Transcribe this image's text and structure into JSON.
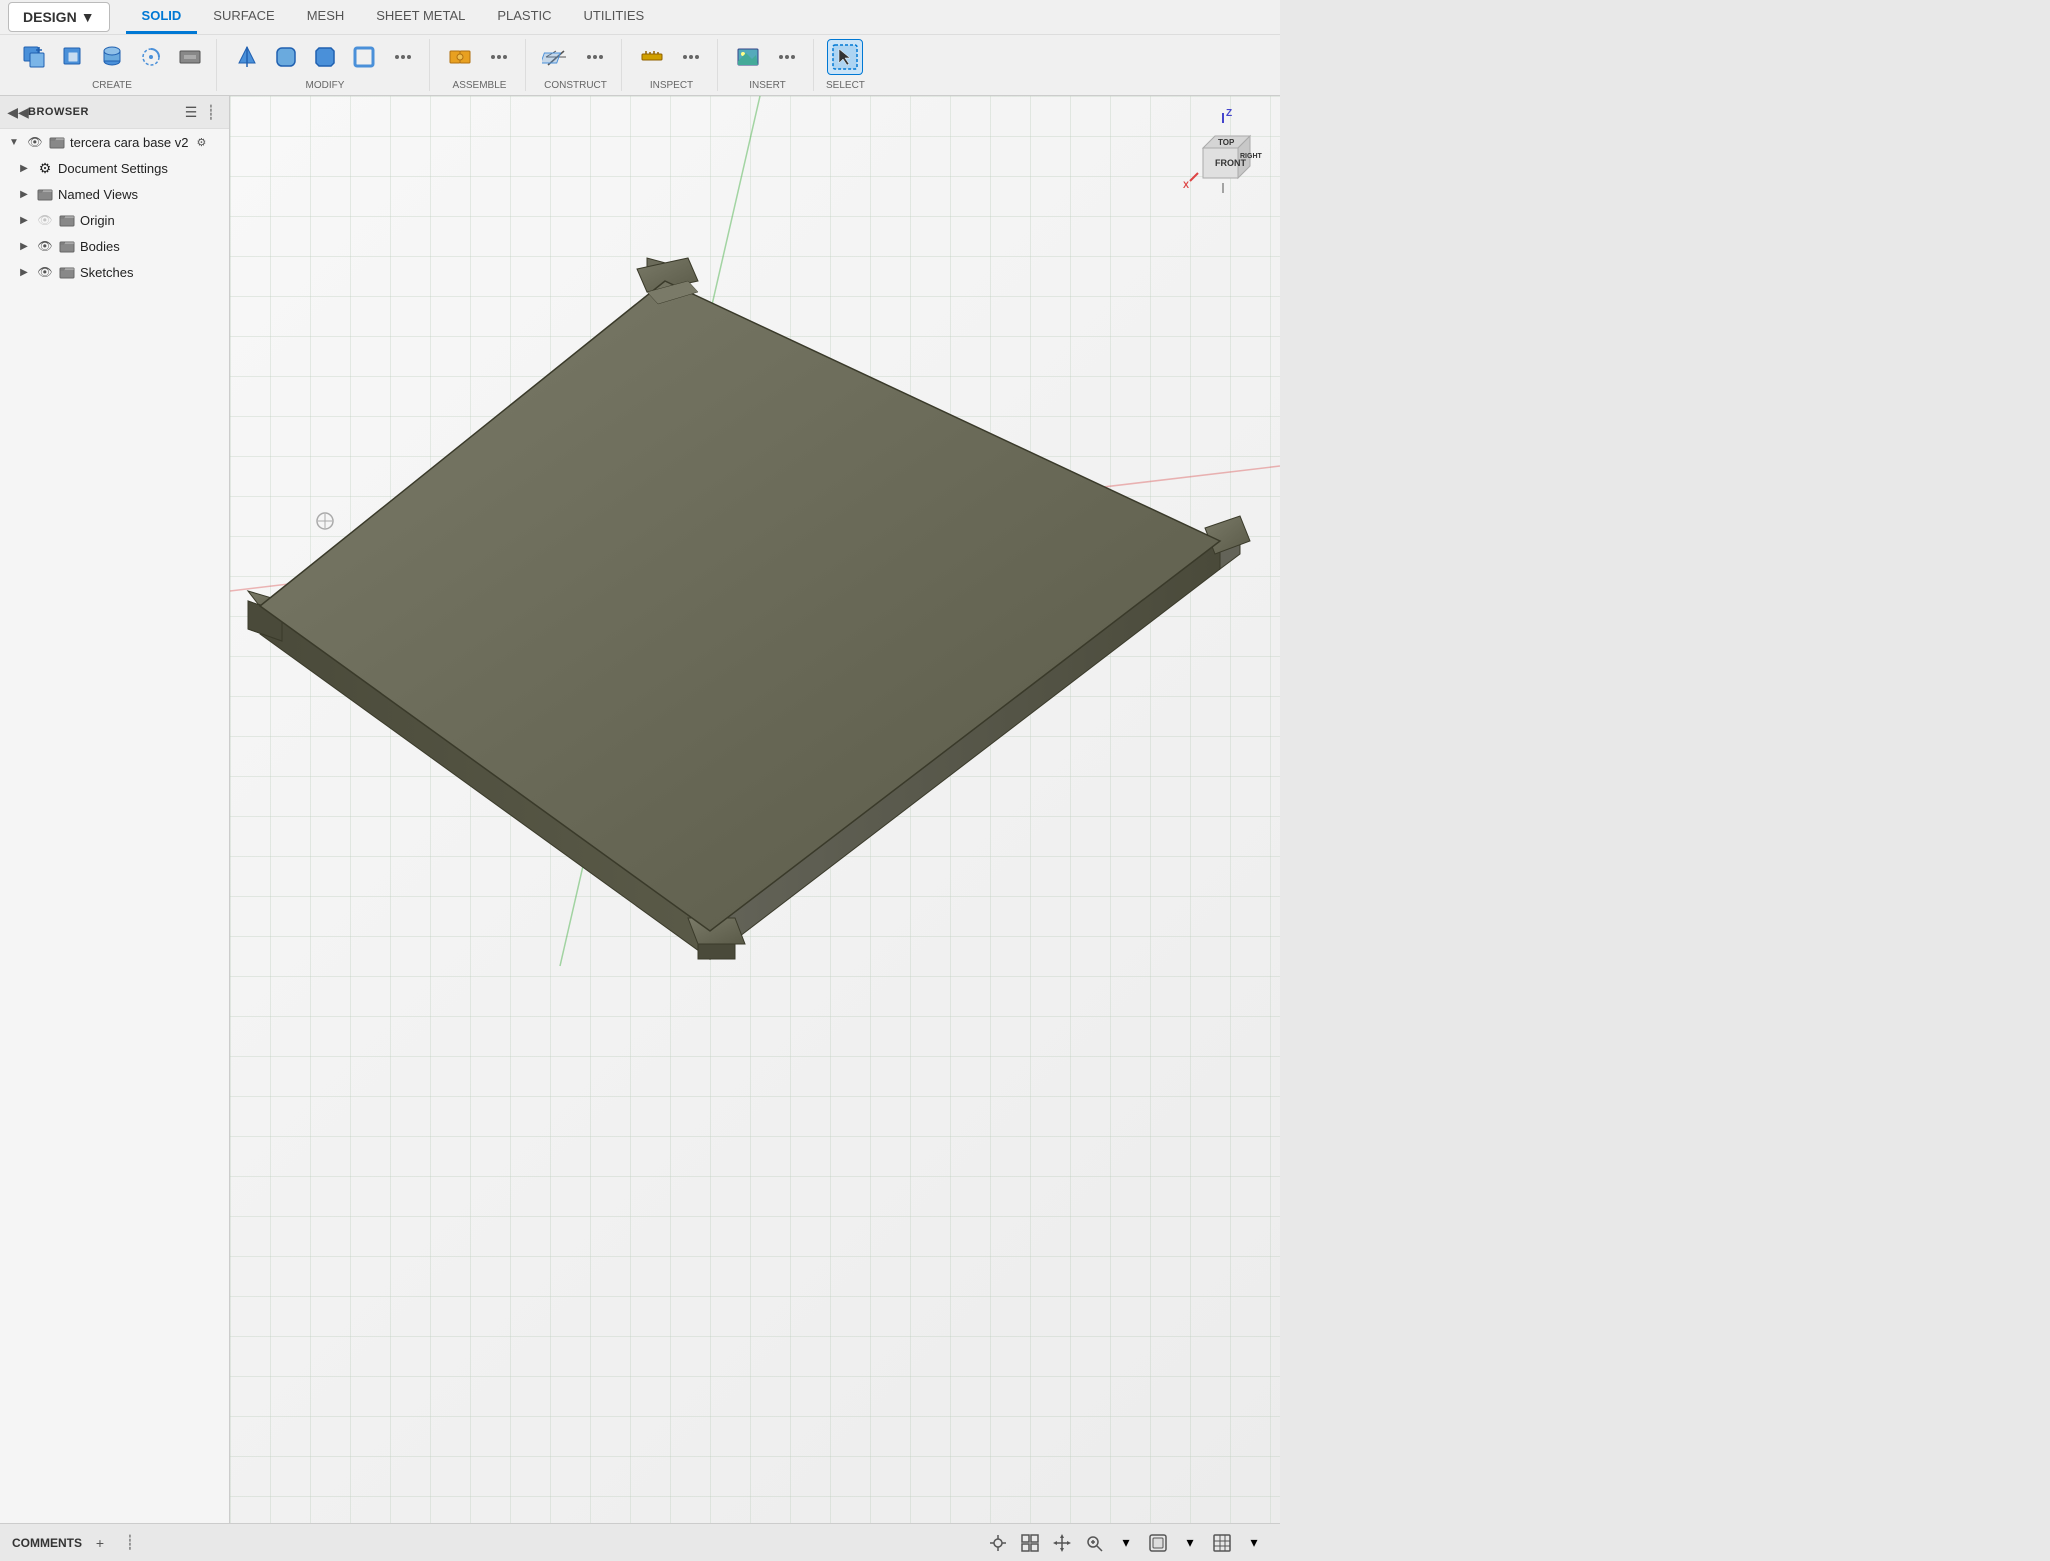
{
  "design_btn": {
    "label": "DESIGN",
    "arrow": "▼"
  },
  "tabs": [
    {
      "id": "solid",
      "label": "SOLID",
      "active": true
    },
    {
      "id": "surface",
      "label": "SURFACE",
      "active": false
    },
    {
      "id": "mesh",
      "label": "MESH",
      "active": false
    },
    {
      "id": "sheet_metal",
      "label": "SHEET METAL",
      "active": false
    },
    {
      "id": "plastic",
      "label": "PLASTIC",
      "active": false
    },
    {
      "id": "utilities",
      "label": "UTILITIES",
      "active": false
    }
  ],
  "toolbar": {
    "groups": [
      {
        "label": "CREATE",
        "has_arrow": true,
        "icons": [
          "create1",
          "create2",
          "create3",
          "create4",
          "create5"
        ]
      },
      {
        "label": "MODIFY",
        "has_arrow": true,
        "icons": [
          "modify1",
          "modify2",
          "modify3",
          "modify4",
          "modify5"
        ]
      },
      {
        "label": "ASSEMBLE",
        "has_arrow": true,
        "icons": [
          "assemble1",
          "assemble2"
        ]
      },
      {
        "label": "CONSTRUCT",
        "has_arrow": true,
        "icons": [
          "construct1",
          "construct2"
        ]
      },
      {
        "label": "INSPECT",
        "has_arrow": true,
        "icons": [
          "inspect1",
          "inspect2"
        ]
      },
      {
        "label": "INSERT",
        "has_arrow": true,
        "icons": [
          "insert1",
          "insert2"
        ]
      },
      {
        "label": "SELECT",
        "has_arrow": true,
        "icons": [
          "select1"
        ]
      }
    ]
  },
  "browser": {
    "header": "BROWSER",
    "collapse_label": "◀◀",
    "items": [
      {
        "id": "root",
        "label": "tercera cara base v2",
        "level": 0,
        "expanded": true,
        "has_eye": true,
        "icon": "folder"
      },
      {
        "id": "doc-settings",
        "label": "Document Settings",
        "level": 1,
        "expanded": false,
        "has_eye": false,
        "icon": "gear"
      },
      {
        "id": "named-views",
        "label": "Named Views",
        "level": 1,
        "expanded": false,
        "has_eye": false,
        "icon": "folder"
      },
      {
        "id": "origin",
        "label": "Origin",
        "level": 1,
        "expanded": false,
        "has_eye": true,
        "eye_hidden": true,
        "icon": "folder"
      },
      {
        "id": "bodies",
        "label": "Bodies",
        "level": 1,
        "expanded": false,
        "has_eye": true,
        "icon": "folder"
      },
      {
        "id": "sketches",
        "label": "Sketches",
        "level": 1,
        "expanded": false,
        "has_eye": true,
        "icon": "folder"
      }
    ]
  },
  "bottom": {
    "comments_label": "COMMENTS",
    "add_btn": "+"
  },
  "viewport": {
    "model_color": "#6b6b5a",
    "model_shadow": "#4a4a3a"
  }
}
